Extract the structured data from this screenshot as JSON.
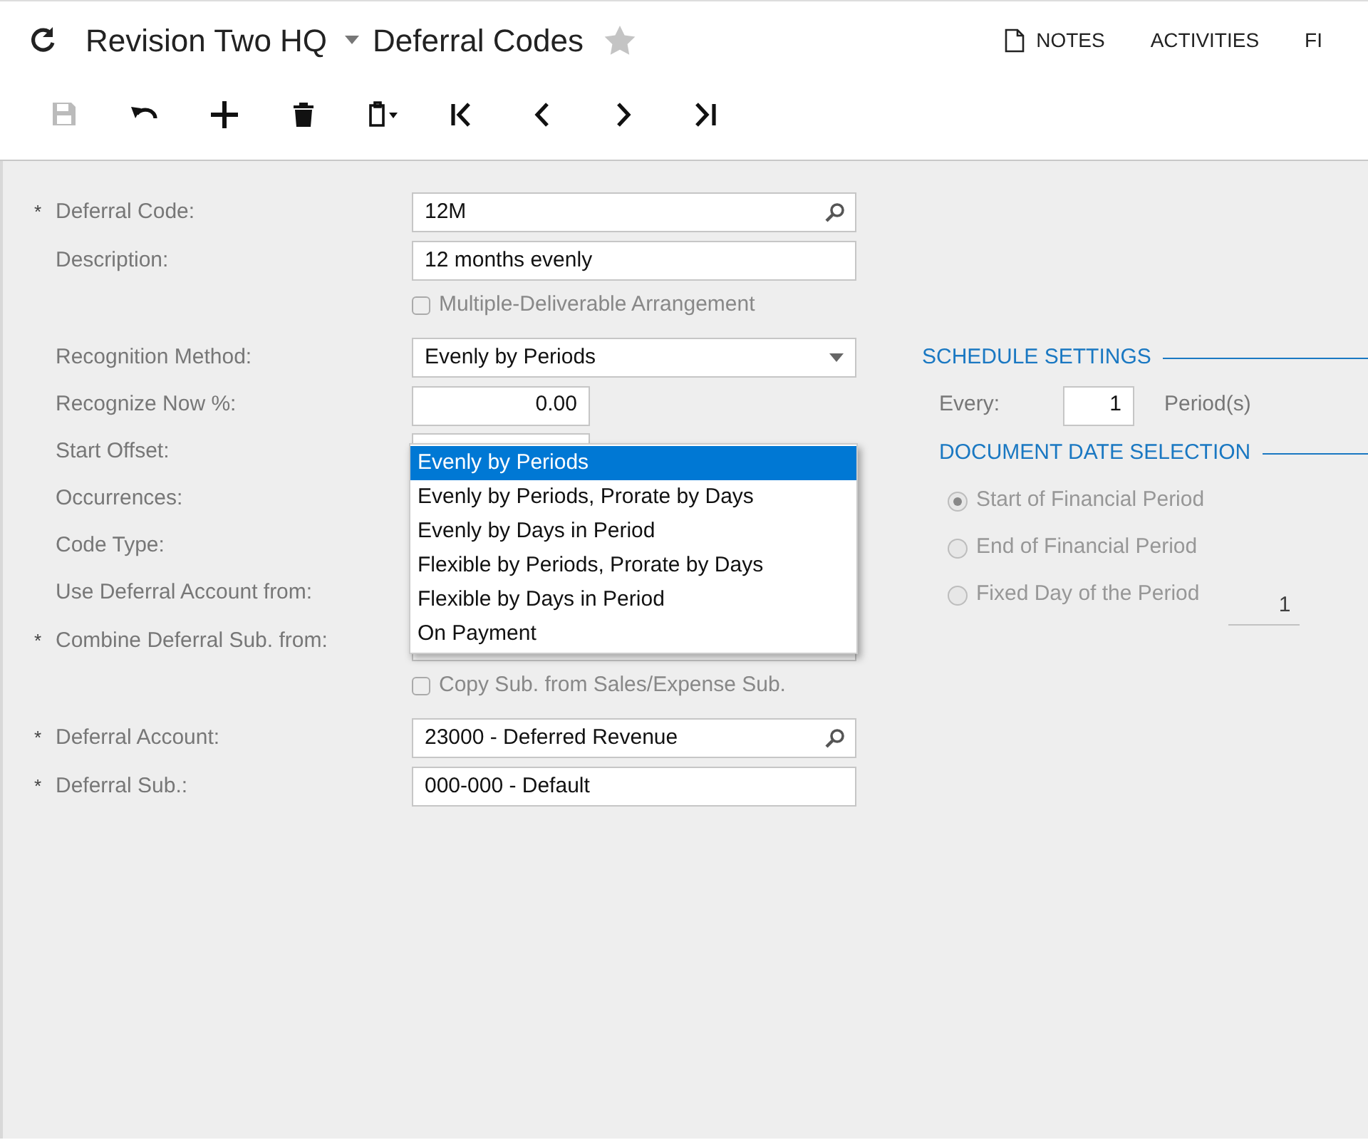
{
  "header": {
    "company": "Revision Two HQ",
    "screen": "Deferral Codes",
    "favorite": false,
    "actions": [
      {
        "label": "NOTES",
        "kind": "notes"
      },
      {
        "label": "ACTIVITIES",
        "kind": "plain"
      },
      {
        "label": "FI",
        "kind": "plain"
      }
    ]
  },
  "toolbar": [
    {
      "kind": "save",
      "disabled": true
    },
    {
      "kind": "undo",
      "disabled": false
    },
    {
      "kind": "add",
      "disabled": false
    },
    {
      "kind": "delete",
      "disabled": false
    },
    {
      "kind": "paste",
      "disabled": false
    },
    {
      "kind": "first",
      "disabled": false
    },
    {
      "kind": "previous",
      "disabled": false
    },
    {
      "kind": "next",
      "disabled": false
    },
    {
      "kind": "last",
      "disabled": false
    }
  ],
  "form": {
    "rows": [
      {
        "kind": "field",
        "label": "Deferral Code:",
        "marker": "*",
        "value": "12M",
        "lookup": true
      },
      {
        "kind": "field",
        "label": "Description:",
        "value": "12 months evenly"
      },
      {
        "kind": "checkbox",
        "label": "Multiple-Deliverable Arrangement",
        "checked": false
      },
      {
        "kind": "select",
        "label": "Recognition Method:",
        "value": "Evenly by Periods"
      },
      {
        "kind": "number",
        "label": "Recognize Now %:",
        "value": "0.00"
      },
      {
        "kind": "number",
        "label": "Start Offset:"
      },
      {
        "kind": "label",
        "label": "Occurrences:"
      },
      {
        "kind": "label",
        "label": "Code Type:"
      },
      {
        "kind": "label",
        "label": "Use Deferral Account from:"
      },
      {
        "kind": "field",
        "label": "Combine Deferral Sub. from:",
        "marker": "*"
      },
      {
        "kind": "checkbox",
        "label": "Copy Sub. from Sales/Expense Sub.",
        "checked": false
      },
      {
        "kind": "field",
        "label": "Deferral Account:",
        "marker": "*",
        "value": "23000 - Deferred Revenue",
        "lookup": true
      },
      {
        "kind": "field",
        "label": "Deferral Sub.:",
        "marker": "*",
        "value": "000-000 - Default"
      }
    ]
  },
  "dropdown": {
    "options": [
      {
        "label": "Evenly by Periods",
        "selected": true
      },
      {
        "label": "Evenly by Periods, Prorate by Days",
        "selected": false
      },
      {
        "label": "Evenly by Days in Period",
        "selected": false
      },
      {
        "label": "Flexible by Periods, Prorate by Days",
        "selected": false
      },
      {
        "label": "Flexible by Days in Period",
        "selected": false
      },
      {
        "label": "On Payment",
        "selected": false
      }
    ]
  },
  "schedule": {
    "title": "SCHEDULE SETTINGS",
    "every_label": "Every:",
    "every_value": "1",
    "unit": "Period(s)"
  },
  "document_date": {
    "title": "DOCUMENT DATE SELECTION",
    "disabled": true,
    "options": [
      {
        "label": "Start of Financial Period",
        "selected": true
      },
      {
        "label": "End of Financial Period",
        "selected": false
      },
      {
        "label": "Fixed Day of the Period",
        "selected": false,
        "day": "1"
      }
    ]
  }
}
